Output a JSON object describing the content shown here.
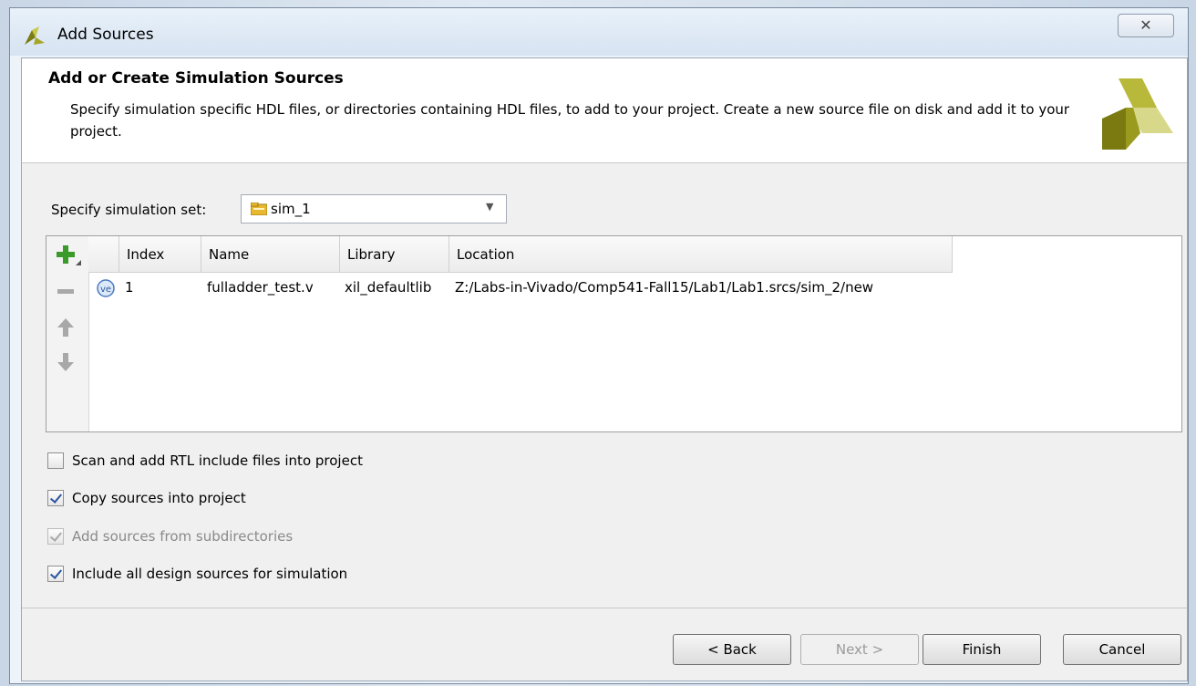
{
  "window": {
    "title": "Add Sources",
    "close_glyph": "✕"
  },
  "header": {
    "title": "Add or Create Simulation Sources",
    "description": "Specify simulation specific HDL files, or directories containing HDL files, to add to your project. Create a new source file on disk and add it to your project."
  },
  "sim_set": {
    "label": "Specify simulation set:",
    "value": "sim_1",
    "icon": "folder-icon"
  },
  "toolbar": {
    "add_icon": "plus-icon",
    "remove_icon": "minus-icon",
    "up_icon": "arrow-up-icon",
    "down_icon": "arrow-down-icon"
  },
  "table": {
    "columns": [
      "Index",
      "Name",
      "Library",
      "Location"
    ],
    "rows": [
      {
        "badge": "ve",
        "index": "1",
        "name": "fulladder_test.v",
        "library": "xil_defaultlib",
        "location": "Z:/Labs-in-Vivado/Comp541-Fall15/Lab1/Lab1.srcs/sim_2/new"
      }
    ]
  },
  "options": [
    {
      "label": "Scan and add RTL include files into project",
      "checked": false,
      "enabled": true
    },
    {
      "label": "Copy sources into project",
      "checked": true,
      "enabled": true
    },
    {
      "label": "Add sources from subdirectories",
      "checked": true,
      "enabled": false
    },
    {
      "label": "Include all design sources for simulation",
      "checked": true,
      "enabled": true
    }
  ],
  "buttons": {
    "back": "< Back",
    "next": "Next >",
    "finish": "Finish",
    "cancel": "Cancel"
  },
  "colors": {
    "accent": "#2a55a0",
    "logo_dark": "#8a8a14",
    "logo_light": "#d6d67a",
    "add_green": "#3a9a2a"
  }
}
